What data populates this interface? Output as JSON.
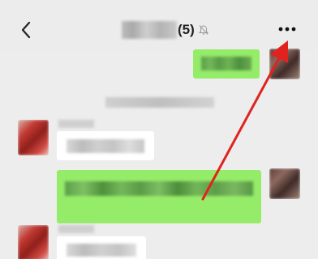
{
  "header": {
    "back_icon": "chevron-left-icon",
    "title_count": "(5)",
    "mute_icon": "bell-off-icon",
    "more_icon": "more-icon"
  },
  "colors": {
    "sent_bubble": "#95ec69",
    "received_bubble": "#ffffff",
    "background": "#ededed",
    "annotation_arrow": "#e0231f"
  }
}
